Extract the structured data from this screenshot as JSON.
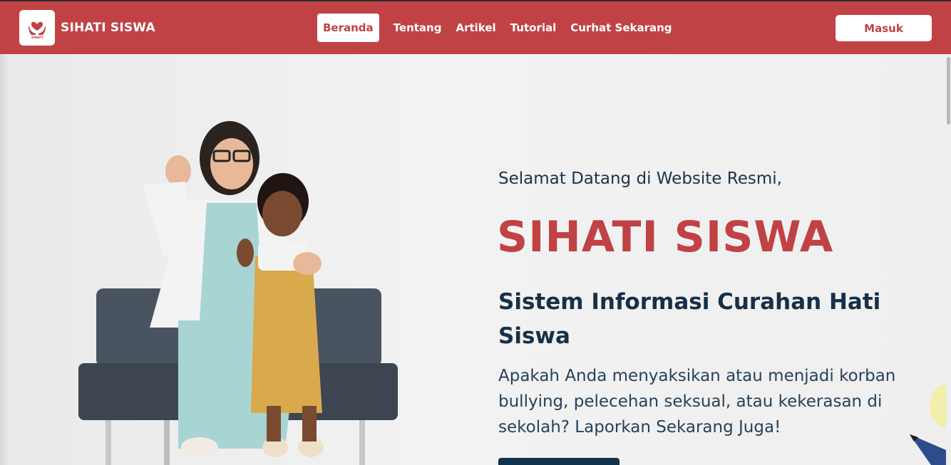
{
  "header": {
    "brand": "SIHATI SISWA",
    "logo_text": "SIHATI",
    "nav": [
      {
        "label": "Beranda",
        "active": true
      },
      {
        "label": "Tentang",
        "active": false
      },
      {
        "label": "Artikel",
        "active": false
      },
      {
        "label": "Tutorial",
        "active": false
      },
      {
        "label": "Curhat Sekarang",
        "active": false
      }
    ],
    "login_label": "Masuk"
  },
  "hero": {
    "welcome": "Selamat Datang di Website Resmi,",
    "title": "SIHATI SISWA",
    "subtitle": "Sistem Informasi Curahan Hati Siswa",
    "description": "Apakah Anda menyaksikan atau menjadi korban bullying, pelecehan seksual, atau kekerasan di sekolah? Laporkan Sekarang Juga!"
  },
  "colors": {
    "brand_red": "#c04245",
    "navy": "#163047",
    "white": "#ffffff"
  },
  "icons": {
    "logo": "hands-heart-icon"
  }
}
